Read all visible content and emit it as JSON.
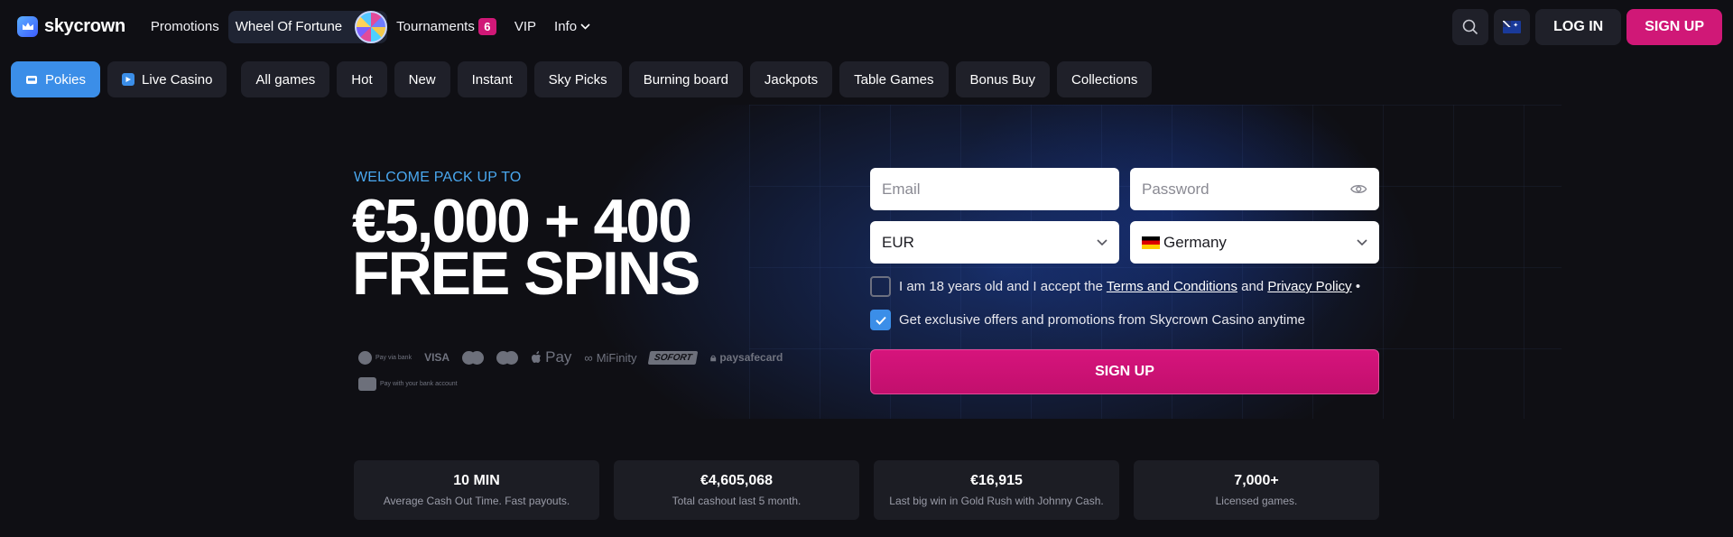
{
  "brand": {
    "name": "skycrown",
    "accent": "#d01877",
    "blue": "#3b8ee8"
  },
  "header": {
    "nav": {
      "promotions": "Promotions",
      "wheel_of_fortune": "Wheel Of Fortune",
      "tournaments": "Tournaments",
      "tournaments_count": "6",
      "vip": "VIP",
      "info": "Info"
    },
    "search_icon": "search-icon",
    "language_flag": "australia-flag-icon",
    "login_label": "LOG IN",
    "signup_label": "SIGN UP"
  },
  "categories": {
    "pokies": "Pokies",
    "live_casino": "Live Casino",
    "all_games": "All games",
    "hot": "Hot",
    "new": "New",
    "instant": "Instant",
    "sky_picks": "Sky Picks",
    "burning_board": "Burning board",
    "jackpots": "Jackpots",
    "table_games": "Table Games",
    "bonus_buy": "Bonus Buy",
    "collections": "Collections"
  },
  "hero": {
    "welcome": "WELCOME PACK UP TO",
    "headline_line1": "€5,000 + 400",
    "headline_line2": "FREE SPINS"
  },
  "payments": {
    "pay_via_bank": "Pay via bank",
    "visa": "VISA",
    "apple_pay": "Pay",
    "mifinity": "MiFinity",
    "sofort": "SOFORT",
    "paysafecard": "paysafecard",
    "pay_with_bank": "Pay with your bank account"
  },
  "form": {
    "email_placeholder": "Email",
    "password_placeholder": "Password",
    "currency": "EUR",
    "country": "Germany",
    "terms_prefix": "I am 18 years old and I accept the",
    "terms_link": "Terms and Conditions",
    "and": "and",
    "privacy_link": "Privacy Policy",
    "required_mark": "•",
    "terms_checked": false,
    "offers_text": "Get exclusive offers and promotions from Skycrown Casino anytime",
    "offers_checked": true,
    "signup_label": "SIGN UP"
  },
  "stats": [
    {
      "value": "10 MIN",
      "desc": "Average Cash Out Time. Fast payouts."
    },
    {
      "value": "€4,605,068",
      "desc": "Total cashout last 5 month."
    },
    {
      "value": "€16,915",
      "desc": "Last big win in Gold Rush with Johnny Cash."
    },
    {
      "value": "7,000+",
      "desc": "Licensed games."
    }
  ]
}
